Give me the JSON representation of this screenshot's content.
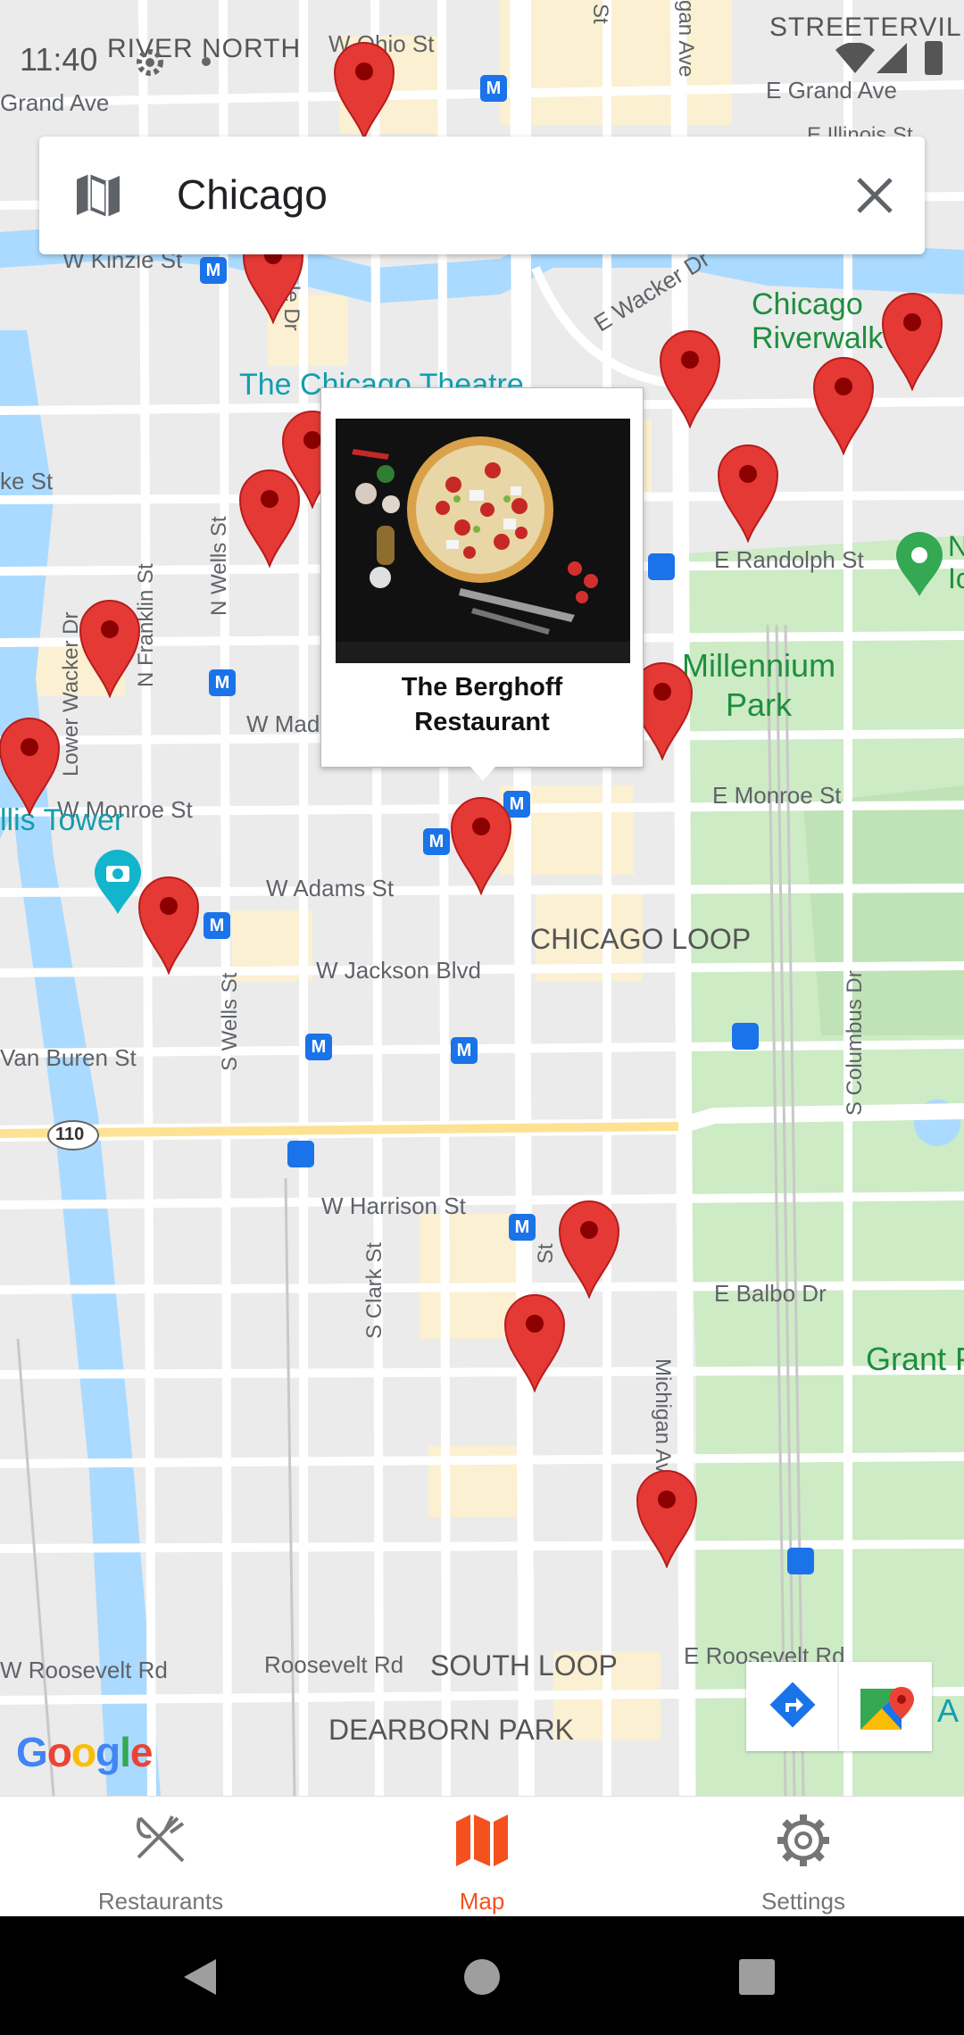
{
  "status_bar": {
    "time": "11:40"
  },
  "search": {
    "query": "Chicago"
  },
  "map": {
    "labels": {
      "river_north": "RIVER NORTH",
      "w_ohio_st": "W Ohio St",
      "streeterville": "STREETERVIL",
      "grand_ave": "Grand Ave",
      "e_grand_ave": "E Grand Ave",
      "e_illinois_st": "E Illinois St",
      "w_kinzie_st": "W Kinzie St",
      "e_wacker_dr": "E Wacker Dr",
      "chicago_riverwalk": "Chicago\nRiverwalk",
      "chicago_theatre": "The Chicago Theatre",
      "lake_st": "ke St",
      "e_randolph_st": "E Randolph St",
      "millennium_park": "Millennium\nPark",
      "w_madison": "W Mad",
      "w_monroe_st": "W Monroe St",
      "e_monroe_st": "E Monroe St",
      "willis_tower": "llis Tower",
      "w_adams_st": "W Adams St",
      "chicago_loop": "CHICAGO LOOP",
      "w_jackson_blvd": "W Jackson Blvd",
      "van_buren_st": "Van Buren St",
      "s_wells_st": "S Wells St",
      "n_wells_st": "N Wells St",
      "n_franklin_st": "N Franklin St",
      "lower_wacker_dr": "Lower Wacker Dr",
      "s_columbus_dr": "S Columbus Dr",
      "hwy_110": "110",
      "w_harrison_st": "W Harrison St",
      "s_clark_st": "S Clark St",
      "michigan_ave": "Michigan Ave",
      "e_balbo_dr": "E Balbo Dr",
      "grant_park": "Grant P",
      "w_roosevelt_rd": "W Roosevelt Rd",
      "roosevelt_rd": "Roosevelt Rd",
      "south_loop": "SOUTH LOOP",
      "e_roosevelt_rd": "E Roosevelt Rd",
      "dearborn_park": "DEARBORN PARK",
      "st_fragment_top": "St",
      "gan_ave_fragment": "gan Ave",
      "st_fragment_bottom": "St",
      "dr_fragment": "le Dr",
      "n_fragment": "N\nIc",
      "a_fragment": "A"
    },
    "google_logo": "Google"
  },
  "popup": {
    "restaurant_name": "The Berghoff\nRestaurant"
  },
  "bottom_nav": {
    "items": [
      {
        "label": "Restaurants",
        "icon": "fork-knife-icon"
      },
      {
        "label": "Map",
        "icon": "map-icon"
      },
      {
        "label": "Settings",
        "icon": "gear-icon"
      }
    ],
    "active_index": 1
  },
  "colors": {
    "accent": "#f4511e",
    "pin": "#e53935",
    "water": "#aadaff",
    "park": "#c8e6c9"
  }
}
